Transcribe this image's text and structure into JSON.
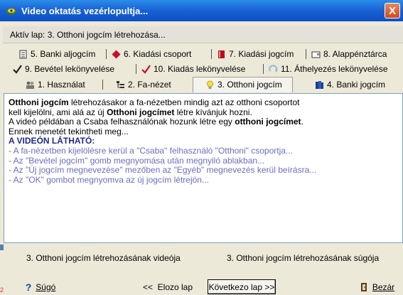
{
  "window": {
    "title": "Video oktatás vezérlopultja...",
    "close_glyph": "X"
  },
  "active_tab_label": "Aktív lap: 3. Otthoni jogcím létrehozása...",
  "tabs": {
    "row1": [
      {
        "label": "5. Banki aljogcím",
        "icon": "document-stack-icon"
      },
      {
        "label": "6. Kiadási csoport",
        "icon": "red-diamond-icon"
      },
      {
        "label": "7. Kiadási jogcím",
        "icon": "red-book-icon"
      },
      {
        "label": "8. Alappénztárca",
        "icon": "wallet-icon"
      }
    ],
    "row2": [
      {
        "label": "9. Bevétel lekönyvelése",
        "icon": "checkmark-icon"
      },
      {
        "label": "10. Kiadás lekönyvelése",
        "icon": "red-checkmark-icon"
      },
      {
        "label": "11. Áthelyezés lekönyvelése",
        "icon": "transfer-arrow-icon"
      }
    ],
    "row3": [
      {
        "label": "1. Használat",
        "icon": "users-icon"
      },
      {
        "label": "2. Fa-nézet",
        "icon": "tree-view-icon"
      },
      {
        "label": "3. Otthoni jogcím",
        "icon": "lightbulb-icon",
        "selected": true
      },
      {
        "label": "4. Banki jogcím",
        "icon": "blue-books-icon"
      }
    ]
  },
  "content": {
    "p1_b1": "Otthoni jogcím",
    "p1_t1": " létrehozásakor a fa-nézetben mindig azt az otthoni csoportot",
    "p1_t2": "kell kijelölni, ami alá az új ",
    "p1_b2": "Otthoni jogcímet",
    "p1_t3": " létre kívánjuk hozni.",
    "p1_t4": "A videó példában a Csaba felhasználónak hozunk létre egy ",
    "p1_b3": "otthoni jogcímet",
    "p1_t5": ".",
    "p1_t6": "Ennek menetét tekintheti meg...",
    "heading": "A VIDEÓN LÁTHATÓ:",
    "bullets": [
      "- A fa-nézetben kijelölésre kerül a \"Csaba\" felhasználó \"Otthoni\" csoportja...",
      "- Az \"Bevétel jogcím\" gomb megnyomása után megnyiló ablakban...",
      "- Az \"Új jogcím megnevezése\" mezőben az \"Egyéb\" megnevezés kerül beírásra...",
      "- Az \"OK\" gombot megnyomva az új jogcím létrejön..."
    ]
  },
  "bottom_tabs": {
    "video": "3. Otthoni jogcím létrehozásának videója",
    "help": "3. Otthoni jogcím létrehozásának súgója"
  },
  "buttons": {
    "help": "Súgó",
    "help_icon": "?",
    "prev": "<<  Elozo lap",
    "next": "Következo lap >>",
    "close": "Bezár"
  },
  "edge_number": "2"
}
